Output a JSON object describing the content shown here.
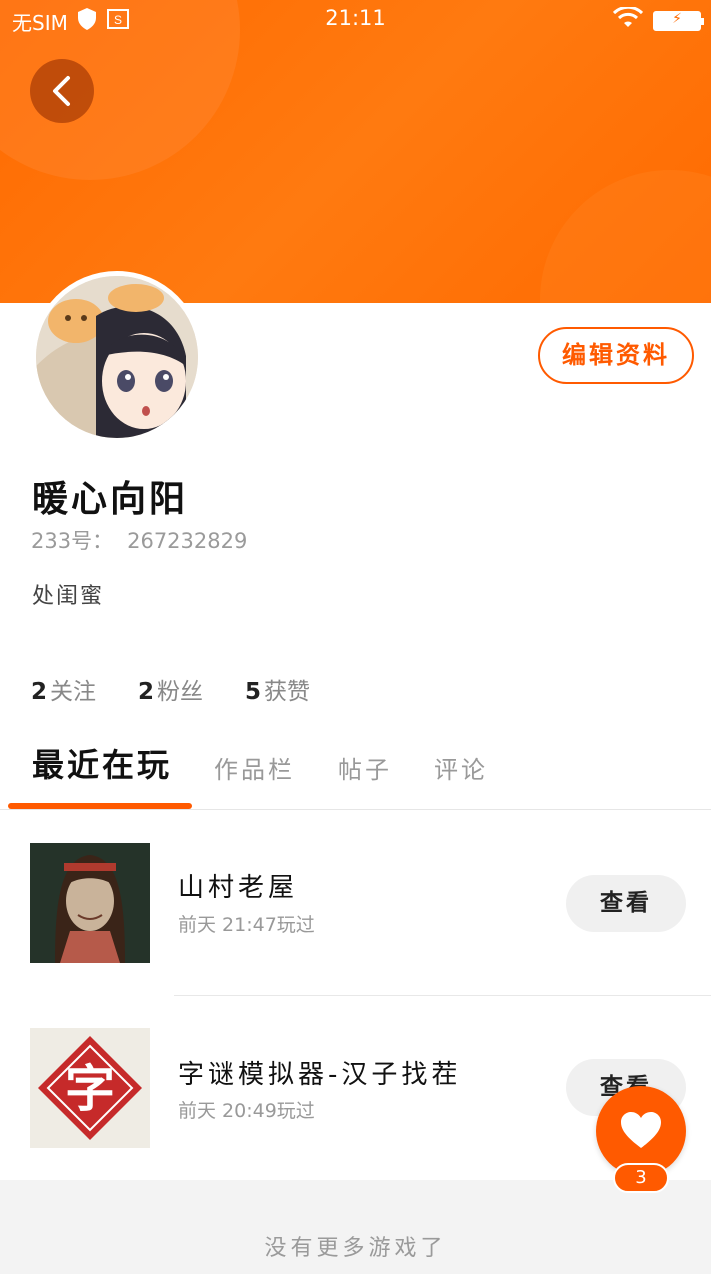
{
  "status_bar": {
    "sim": "无SIM",
    "time": "21:11"
  },
  "profile": {
    "edit_label": "编辑资料",
    "nickname": "暖心向阳",
    "uid_label": "233号：",
    "uid_value": "267232829",
    "bio": "处闺蜜"
  },
  "stats": [
    {
      "num": "2",
      "label": "关注"
    },
    {
      "num": "2",
      "label": "粉丝"
    },
    {
      "num": "5",
      "label": "获赞"
    }
  ],
  "tabs": [
    {
      "label": "最近在玩",
      "active": true
    },
    {
      "label": "作品栏",
      "active": false
    },
    {
      "label": "帖子",
      "active": false
    },
    {
      "label": "评论",
      "active": false
    }
  ],
  "games": [
    {
      "title": "山村老屋",
      "time": "前天 21:47玩过",
      "button": "查看"
    },
    {
      "title": "字谜模拟器-汉子找茬",
      "time": "前天 20:49玩过",
      "button": "查看",
      "thumb_char": "字"
    }
  ],
  "footer": {
    "text": "没有更多游戏了"
  },
  "fab": {
    "icon": "heart-icon",
    "badge": "3"
  },
  "colors": {
    "accent": "#ff5a00",
    "header": "#ff6a00"
  }
}
